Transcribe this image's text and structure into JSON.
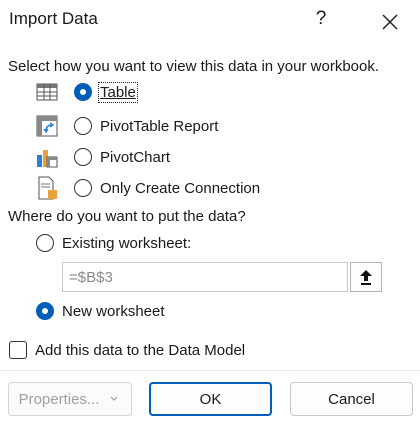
{
  "dialog": {
    "title": "Import Data",
    "help_label": "?"
  },
  "view_section": {
    "prompt": "Select how you want to view this data in your workbook.",
    "options": [
      {
        "label": "Table",
        "selected": true,
        "icon": "table-icon"
      },
      {
        "label": "PivotTable Report",
        "selected": false,
        "icon": "pivottable-icon"
      },
      {
        "label": "PivotChart",
        "selected": false,
        "icon": "pivotchart-icon"
      },
      {
        "label": "Only Create Connection",
        "selected": false,
        "icon": "connection-icon"
      }
    ]
  },
  "location_section": {
    "prompt": "Where do you want to put the data?",
    "existing_label": "Existing worksheet:",
    "existing_selected": false,
    "range_value": "=$B$3",
    "new_label": "New worksheet",
    "new_selected": true
  },
  "data_model": {
    "label": "Add this data to the Data Model",
    "checked": false
  },
  "buttons": {
    "properties_label": "Properties...",
    "ok_label": "OK",
    "cancel_label": "Cancel"
  },
  "colors": {
    "accent": "#005fb8",
    "disabled_text": "#a0a0a0"
  }
}
